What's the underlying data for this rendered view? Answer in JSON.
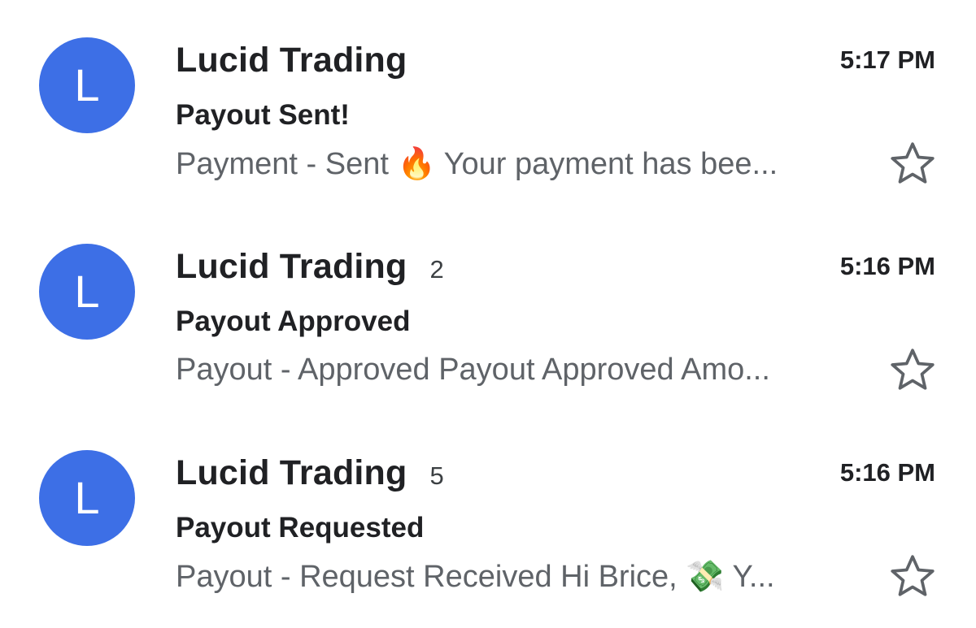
{
  "emails": [
    {
      "avatar_letter": "L",
      "avatar_color": "#3d6fe6",
      "sender": "Lucid Trading",
      "count": "",
      "time": "5:17 PM",
      "subject": "Payout Sent!",
      "snippet": "Payment - Sent 🔥 Your payment has bee...",
      "starred": false
    },
    {
      "avatar_letter": "L",
      "avatar_color": "#3d6fe6",
      "sender": "Lucid Trading",
      "count": "2",
      "time": "5:16 PM",
      "subject": "Payout Approved",
      "snippet": "Payout - Approved Payout Approved Amo...",
      "starred": false
    },
    {
      "avatar_letter": "L",
      "avatar_color": "#3d6fe6",
      "sender": "Lucid Trading",
      "count": "5",
      "time": "5:16 PM",
      "subject": "Payout Requested",
      "snippet": "Payout - Request Received Hi Brice, 💸 Y...",
      "starred": false
    }
  ],
  "icons": {
    "star": "star-outline-icon"
  },
  "colors": {
    "star_outline": "#5f6368",
    "sender_text": "#202124",
    "snippet_text": "#5f6368"
  }
}
